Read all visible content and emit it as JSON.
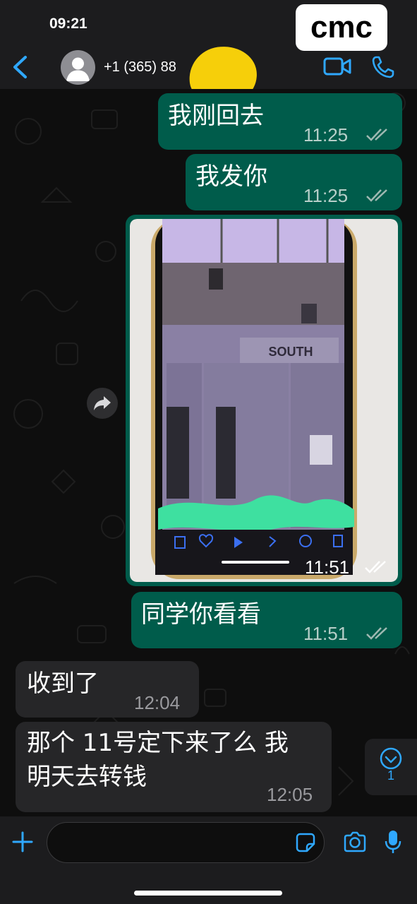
{
  "status_bar": {
    "time": "09:21",
    "badge": "cmc"
  },
  "header": {
    "contact": "+1 (365) 88"
  },
  "messages": [
    {
      "text": "我刚回去",
      "time": "11:25",
      "direction": "out",
      "status": "read"
    },
    {
      "text": "我发你",
      "time": "11:25",
      "direction": "out",
      "status": "read"
    },
    {
      "type": "image",
      "sign": "SOUTH",
      "time": "11:51",
      "direction": "out",
      "status": "read"
    },
    {
      "text": "同学你看看",
      "time": "11:51",
      "direction": "out",
      "status": "read"
    },
    {
      "text": "收到了",
      "time": "12:04",
      "direction": "in"
    },
    {
      "text_line1": "那个 11号定下来了么 我",
      "text_line2": "明天去转钱",
      "time": "12:05",
      "direction": "in"
    }
  ],
  "scroll_badge": {
    "count": "1"
  },
  "composer": {
    "placeholder": ""
  },
  "colors": {
    "accent": "#2fa8ff",
    "outgoing": "#005c4b",
    "incoming": "#262628",
    "read_ticks": "#9fb9b2"
  },
  "icons": [
    "back-chevron-icon",
    "person-icon",
    "video-call-icon",
    "phone-icon",
    "forward-icon",
    "chevron-down-icon",
    "plus-icon",
    "sticker-icon",
    "camera-icon",
    "microphone-icon",
    "double-check-icon"
  ]
}
